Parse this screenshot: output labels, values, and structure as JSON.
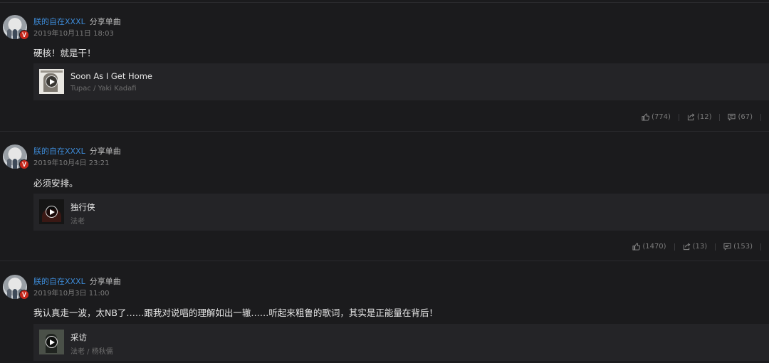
{
  "posts": [
    {
      "username": "朕的自在XXXL",
      "action": "分享单曲",
      "timestamp": "2019年10月11日 18:03",
      "comment": "硬核！就是干！",
      "song": {
        "title": "Soon As I Get Home",
        "artist": "Tupac / Yaki Kadafi"
      },
      "likes": "(774)",
      "shares": "(12)",
      "comments": "(67)"
    },
    {
      "username": "朕的自在XXXL",
      "action": "分享单曲",
      "timestamp": "2019年10月4日 23:21",
      "comment": "必须安排。",
      "song": {
        "title": "独行侠",
        "artist": "法老"
      },
      "likes": "(1470)",
      "shares": "(13)",
      "comments": "(153)"
    },
    {
      "username": "朕的自在XXXL",
      "action": "分享单曲",
      "timestamp": "2019年10月3日 11:00",
      "comment": "我认真走一波，太NB了……跟我对说唱的理解如出一辙……听起来粗鲁的歌词，其实是正能量在背后！",
      "song": {
        "title": "采访",
        "artist": "法老 / 杨秋儒"
      }
    }
  ],
  "badge": "V",
  "colors": {
    "username": "#3d8bd8",
    "badge": "#c6271c",
    "background": "#1b1b1d",
    "card": "#242427"
  },
  "icons": {
    "like": "thumbs-up-icon",
    "share": "share-icon",
    "comment": "comment-icon",
    "play": "play-icon"
  }
}
